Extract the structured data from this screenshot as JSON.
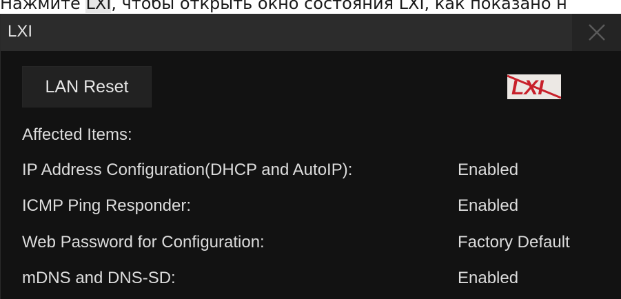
{
  "caption": {
    "before": "Нажмите ",
    "highlight": "LXI",
    "after": ", чтобы открыть окно состояния LXI, как показано н"
  },
  "window": {
    "title": "LXI",
    "close_icon": "close-icon",
    "lan_reset_label": "LAN Reset",
    "logo_text": "LXI",
    "affected_items_label": "Affected Items:",
    "items": [
      {
        "label": "IP Address Configuration(DHCP and AutoIP):",
        "value": "Enabled"
      },
      {
        "label": "ICMP Ping Responder:",
        "value": "Enabled"
      },
      {
        "label": "Web Password for Configuration:",
        "value": "Factory Default"
      },
      {
        "label": "mDNS and DNS-SD:",
        "value": "Enabled"
      }
    ]
  },
  "colors": {
    "window_bg": "#121212",
    "titlebar_bg": "#2c2c2c",
    "text": "#dcdcdc",
    "logo_red": "#c8202a"
  }
}
